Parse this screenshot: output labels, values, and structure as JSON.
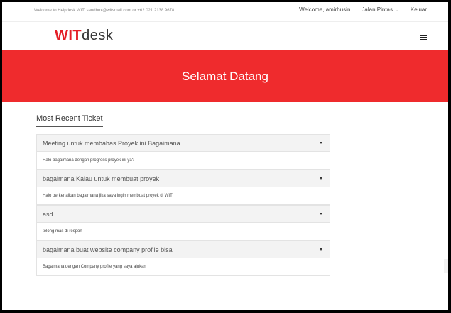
{
  "topbar": {
    "welcome_info": "Welcome to Helpdesk WIT: sandbox@witsmail.com or +62 021 2138 9678",
    "greeting": "Welcome, amirhusin",
    "shortcut_label": "Jalan Pintas",
    "logout_label": "Keluar"
  },
  "brand": {
    "logo_strong": "WIT",
    "logo_light": "desk"
  },
  "hero": {
    "title": "Selamat Datang"
  },
  "main": {
    "section_title": "Most Recent Ticket",
    "tickets": [
      {
        "title": "Meeting untuk membahas Proyek ini Bagaimana",
        "body": "Halo bagaimana dengan progress proyek ini ya?"
      },
      {
        "title": "bagaimana Kalau untuk membuat proyek",
        "body": "Halo perkenalkan bagaimana jika saya ingin membuat proyek di WIT"
      },
      {
        "title": "asd",
        "body": "tolong mas di respon"
      },
      {
        "title": "bagaimana buat website company profile bisa",
        "body": "Bagaimana dengan Company profile yang saya ajukan"
      }
    ]
  },
  "icons": {
    "menu": "hamburger-menu-icon",
    "dropdown": "chevron-down-icon",
    "expand": "caret-down-icon"
  },
  "colors": {
    "brand_red": "#ef2b2d",
    "logo_red": "#e41e26",
    "header_bg": "#f3f3f3"
  }
}
